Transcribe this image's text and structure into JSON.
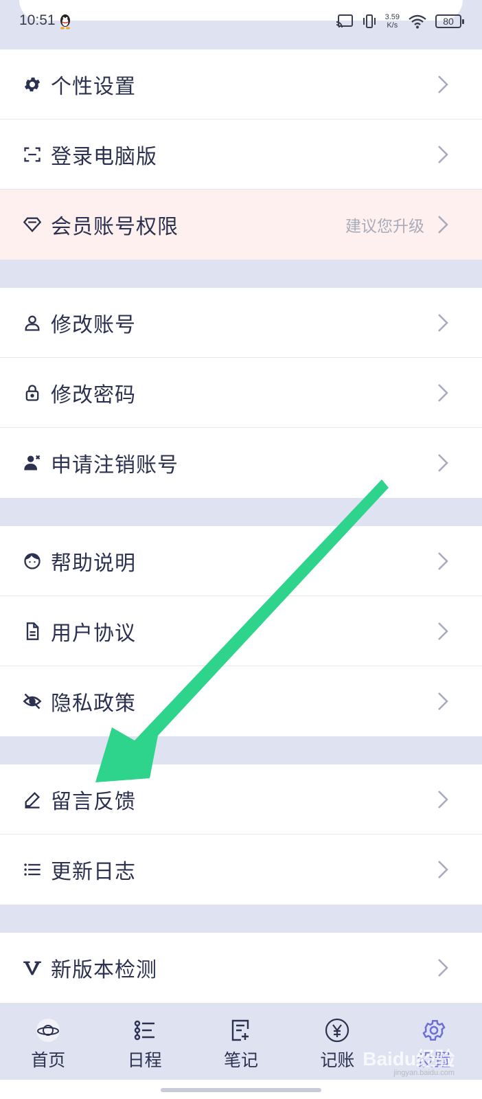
{
  "status_bar": {
    "time": "10:51",
    "net_speed_value": "3.59",
    "net_speed_unit": "K/s",
    "battery": "80"
  },
  "menu": {
    "groups": [
      {
        "items": [
          {
            "label": "个性设置",
            "icon": "gear-icon"
          },
          {
            "label": "登录电脑版",
            "icon": "scan-frame-icon"
          },
          {
            "label": "会员账号权限",
            "icon": "diamond-icon",
            "hint": "建议您升级"
          }
        ]
      },
      {
        "items": [
          {
            "label": "修改账号",
            "icon": "user-icon"
          },
          {
            "label": "修改密码",
            "icon": "lock-icon"
          },
          {
            "label": "申请注销账号",
            "icon": "user-remove-icon"
          }
        ]
      },
      {
        "items": [
          {
            "label": "帮助说明",
            "icon": "face-help-icon"
          },
          {
            "label": "用户协议",
            "icon": "document-icon"
          },
          {
            "label": "隐私政策",
            "icon": "eye-off-icon"
          }
        ]
      },
      {
        "items": [
          {
            "label": "留言反馈",
            "icon": "pencil-icon"
          },
          {
            "label": "更新日志",
            "icon": "list-icon"
          }
        ]
      },
      {
        "items": [
          {
            "label": "新版本检测",
            "icon": "v-letter-icon"
          }
        ]
      }
    ]
  },
  "tabbar": {
    "tabs": [
      {
        "label": "首页",
        "icon": "planet-icon"
      },
      {
        "label": "日程",
        "icon": "schedule-icon"
      },
      {
        "label": "笔记",
        "icon": "note-icon"
      },
      {
        "label": "记账",
        "icon": "yuan-icon"
      },
      {
        "label": "设置",
        "icon": "settings-gear-icon",
        "active": true
      }
    ]
  },
  "watermark": {
    "text": "Baidu经验",
    "url": "jingyan.baidu.com"
  },
  "colors": {
    "background": "#dfe2f0",
    "row": "#ffffff",
    "vip_row": "#fdf0ee",
    "text": "#2c3150",
    "hint": "#a8abbb",
    "accent": "#6b6fd6",
    "arrow": "#2ed38c"
  }
}
